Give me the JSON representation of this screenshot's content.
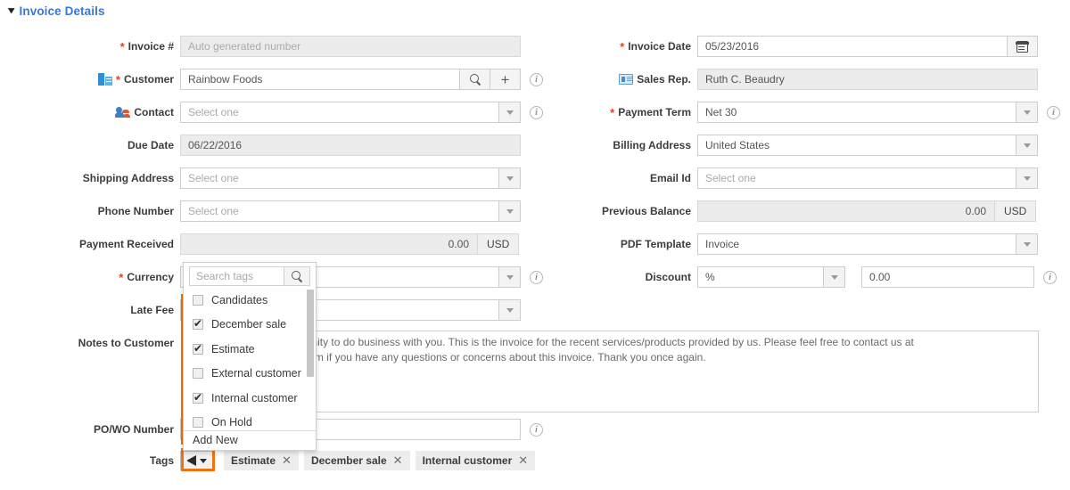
{
  "section": {
    "title": "Invoice Details",
    "caret": "chevron-down-icon"
  },
  "left_fields": {
    "invoice_number": {
      "label": "Invoice #",
      "required": true,
      "placeholder": "Auto generated number",
      "value": ""
    },
    "customer": {
      "label": "Customer",
      "required": true,
      "icon": "building-icon",
      "value": "Rainbow Foods",
      "search_button": "search-icon",
      "add_button": "plus-icon"
    },
    "contact": {
      "label": "Contact",
      "required": false,
      "icon": "contact-icon",
      "placeholder": "Select one",
      "value": ""
    },
    "due_date": {
      "label": "Due Date",
      "value": "06/22/2016"
    },
    "shipping_address": {
      "label": "Shipping Address",
      "placeholder": "Select one",
      "value": ""
    },
    "phone_number": {
      "label": "Phone Number",
      "placeholder": "Select one",
      "value": ""
    },
    "payment_received": {
      "label": "Payment Received",
      "value": "0.00",
      "unit": "USD"
    },
    "currency": {
      "label": "Currency",
      "required": true,
      "value": ""
    },
    "late_fee": {
      "label": "Late Fee",
      "value": ""
    },
    "notes_to_customer": {
      "label": "Notes to Customer",
      "value": "Thank you for the opportunity to do business with you. This is the invoice for the recent services/products provided by us. Please feel free to contact us at Ruth.Beaudry@berijam.com if you have any questions or concerns about this invoice. Thank you once again."
    },
    "po_wo_number": {
      "label": "PO/WO Number",
      "value": ""
    }
  },
  "right_fields": {
    "invoice_date": {
      "label": "Invoice Date",
      "required": true,
      "value": "05/23/2016",
      "button": "calendar-icon"
    },
    "sales_rep": {
      "label": "Sales Rep.",
      "icon": "id-card-icon",
      "value": "Ruth C. Beaudry"
    },
    "payment_term": {
      "label": "Payment Term",
      "required": true,
      "value": "Net 30"
    },
    "billing_address": {
      "label": "Billing Address",
      "value": "United States"
    },
    "email_id": {
      "label": "Email Id",
      "placeholder": "Select one",
      "value": ""
    },
    "previous_balance": {
      "label": "Previous Balance",
      "value": "0.00",
      "unit": "USD"
    },
    "pdf_template": {
      "label": "PDF Template",
      "value": "Invoice"
    },
    "discount": {
      "label": "Discount",
      "type_value": "%",
      "amount_value": "0.00"
    }
  },
  "tags_row": {
    "label": "Tags",
    "tag_button": {
      "icon": "tag-icon",
      "caret": "chevron-down-icon"
    },
    "chips": [
      {
        "label": "Estimate",
        "remove": "✕"
      },
      {
        "label": "December sale",
        "remove": "✕"
      },
      {
        "label": "Internal customer",
        "remove": "✕"
      }
    ]
  },
  "tag_dropdown": {
    "search_placeholder": "Search tags",
    "search_icon": "search-icon",
    "items": [
      {
        "label": "Candidates",
        "checked": false
      },
      {
        "label": "December sale",
        "checked": true
      },
      {
        "label": "Estimate",
        "checked": true
      },
      {
        "label": "External customer",
        "checked": false
      },
      {
        "label": "Internal customer",
        "checked": true
      },
      {
        "label": "On Hold",
        "checked": false
      }
    ],
    "footer_label": "Add New"
  },
  "highlight_color": "#f2720c"
}
